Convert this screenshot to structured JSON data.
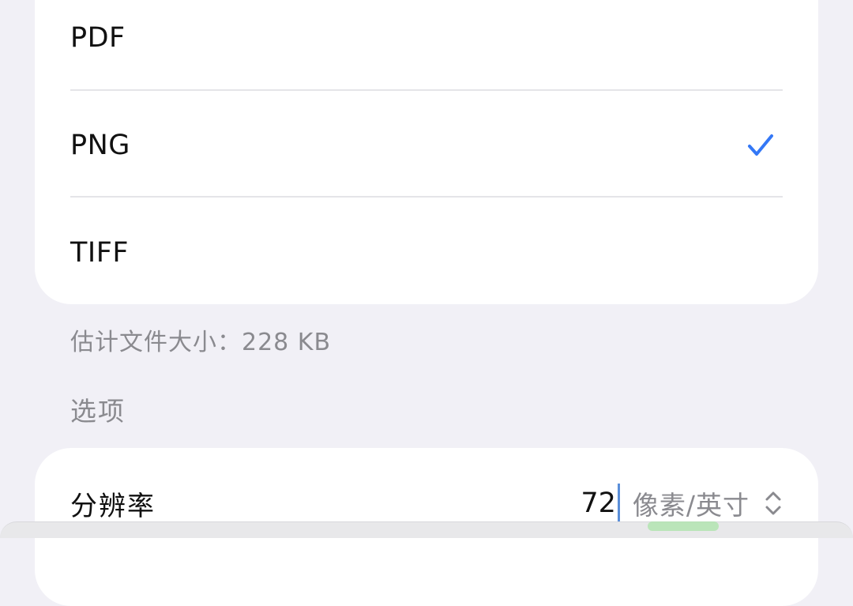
{
  "formats": {
    "items": [
      {
        "label": "PDF",
        "selected": false
      },
      {
        "label": "PNG",
        "selected": true
      },
      {
        "label": "TIFF",
        "selected": false
      }
    ],
    "check_icon": "checkmark-icon",
    "accent_color": "#3478f6"
  },
  "file_size": {
    "text": "估计文件大小：228 KB"
  },
  "options": {
    "section_title": "选项",
    "resolution": {
      "label": "分辨率",
      "value": "72",
      "unit": "像素/英寸",
      "stepper_icon": "chevron-up-down-icon"
    }
  }
}
